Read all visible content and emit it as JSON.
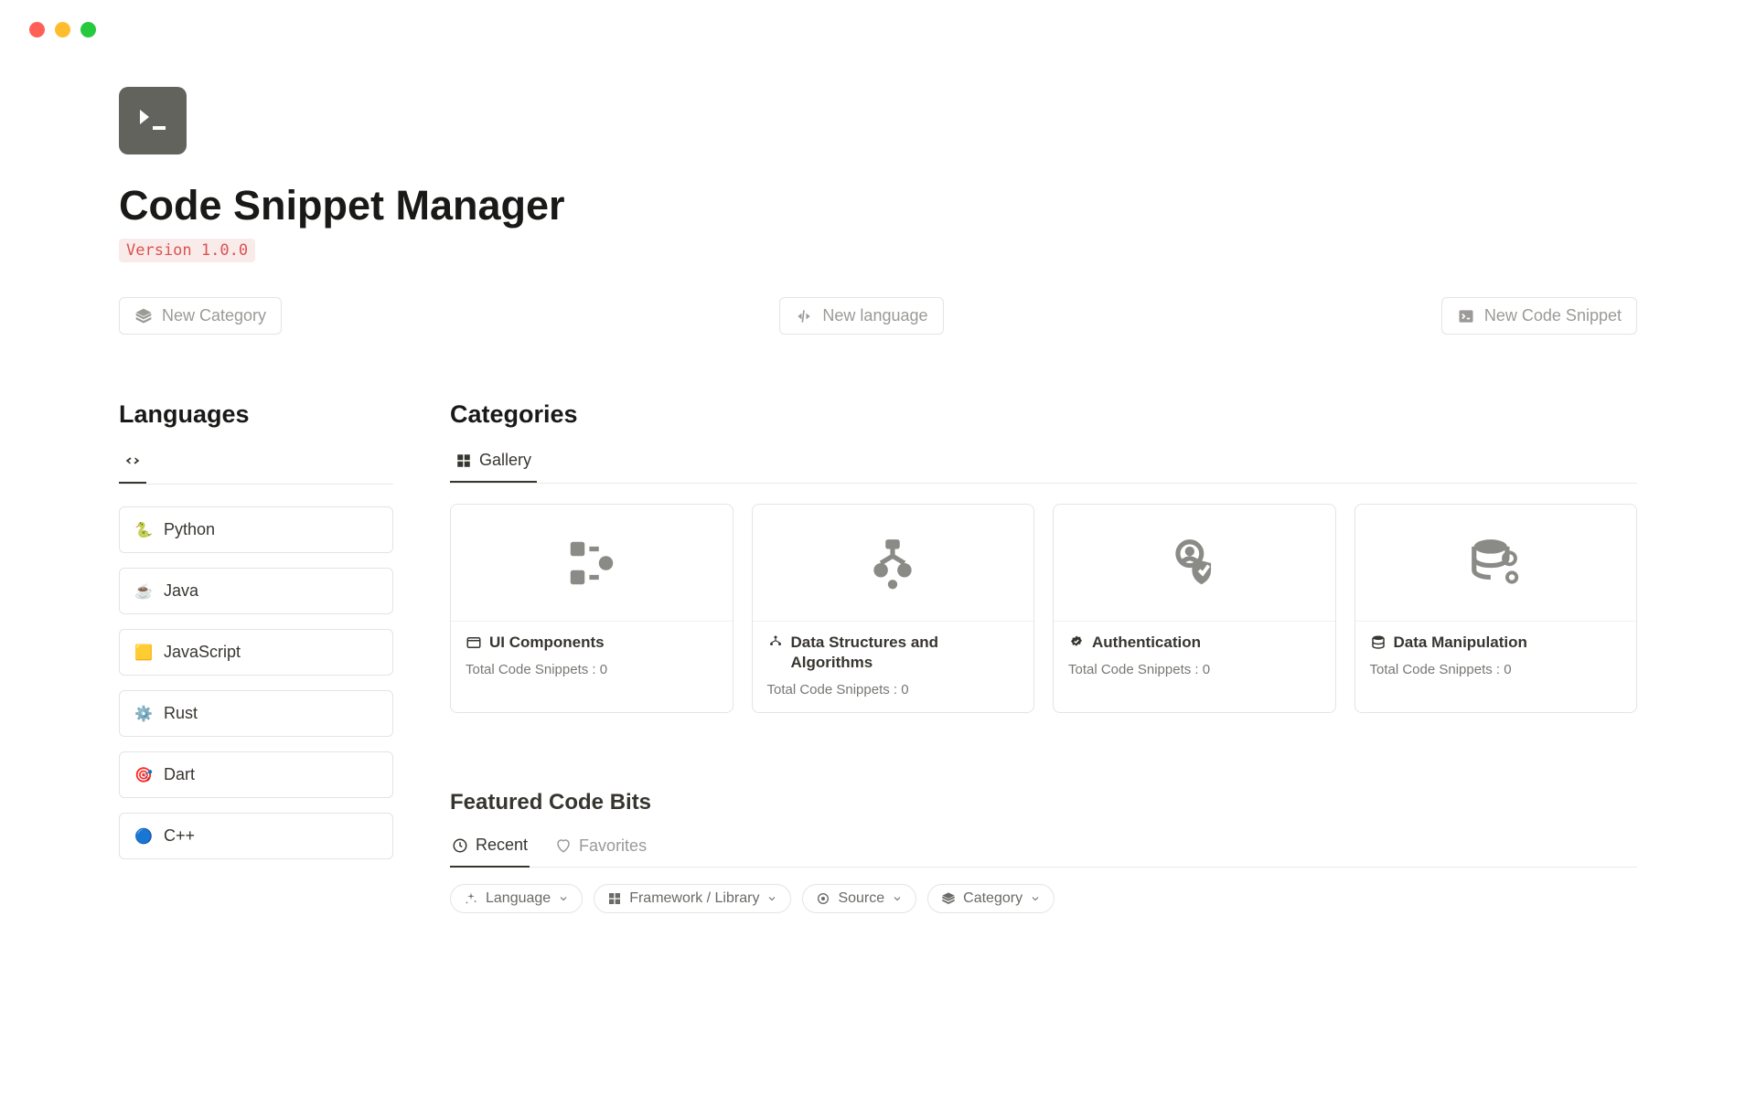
{
  "header": {
    "title": "Code Snippet Manager",
    "version": "Version 1.0.0"
  },
  "actions": {
    "new_category": "New Category",
    "new_language": "New language",
    "new_snippet": "New Code Snippet"
  },
  "languages": {
    "section_title": "Languages",
    "items": [
      {
        "name": "Python",
        "icon": "🐍"
      },
      {
        "name": "Java",
        "icon": "☕"
      },
      {
        "name": "JavaScript",
        "icon": "🟨"
      },
      {
        "name": "Rust",
        "icon": "⚙️"
      },
      {
        "name": "Dart",
        "icon": "🎯"
      },
      {
        "name": "C++",
        "icon": "🔵"
      }
    ]
  },
  "categories": {
    "section_title": "Categories",
    "tab_label": "Gallery",
    "items": [
      {
        "name": "UI Components",
        "meta": "Total Code Snippets : 0"
      },
      {
        "name": "Data Structures and Algorithms",
        "meta": "Total Code Snippets : 0"
      },
      {
        "name": "Authentication",
        "meta": "Total Code Snippets : 0"
      },
      {
        "name": "Data Manipulation",
        "meta": "Total Code Snippets : 0"
      }
    ]
  },
  "featured": {
    "section_title": "Featured Code Bits",
    "tabs": {
      "recent": "Recent",
      "favorites": "Favorites"
    },
    "filters": [
      "Language",
      "Framework / Library",
      "Source",
      "Category"
    ]
  }
}
